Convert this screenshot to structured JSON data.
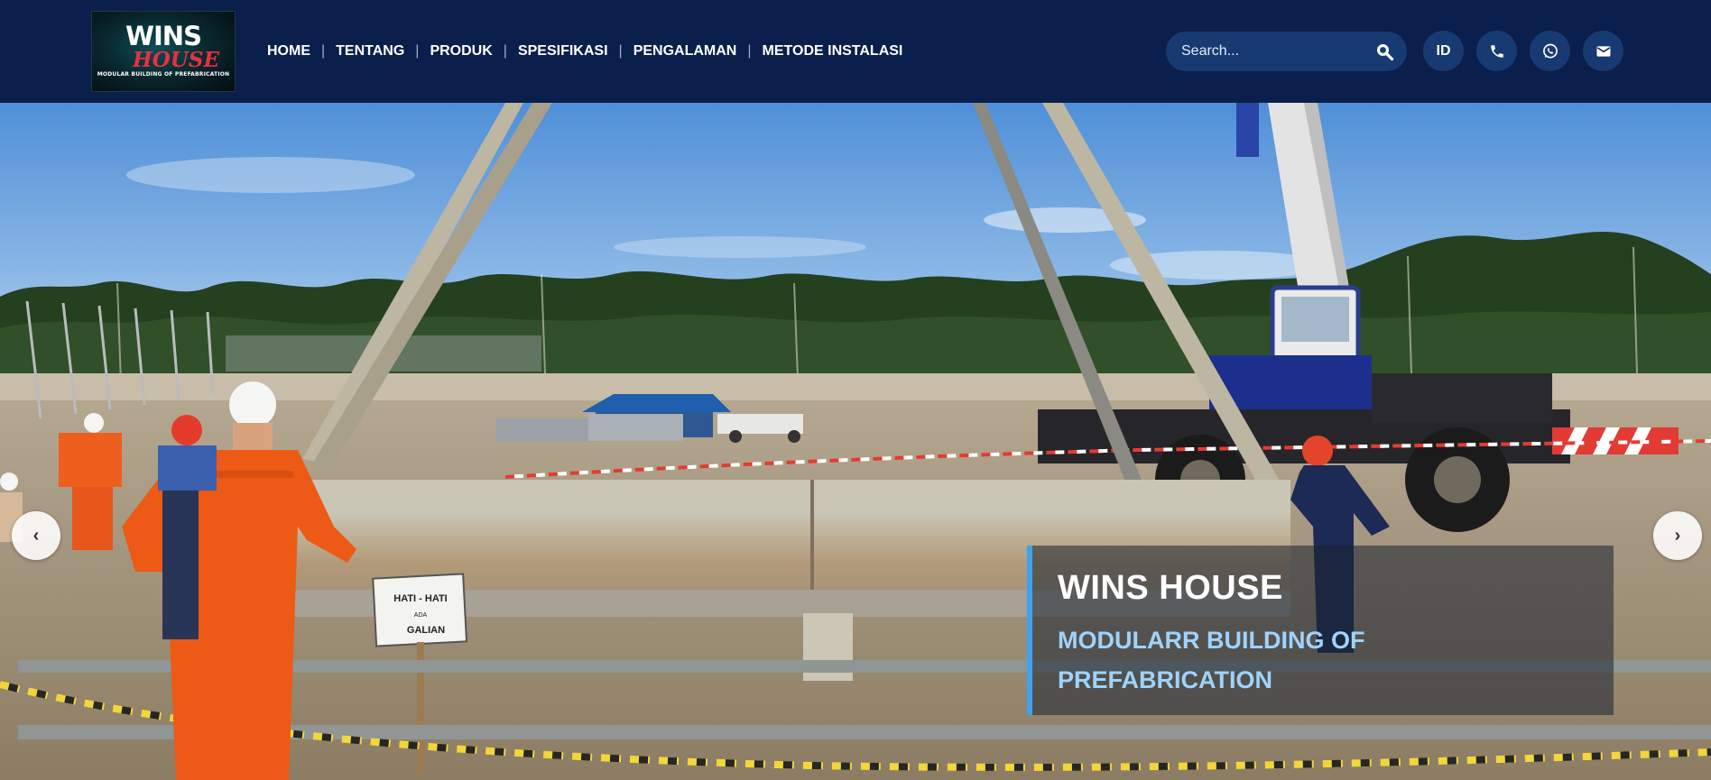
{
  "brand": {
    "logo_line1": "WINS",
    "logo_line2": "HOUSE",
    "logo_tagline": "MODULAR BUILDING OF PREFABRICATION"
  },
  "nav": {
    "items": [
      "HOME",
      "TENTANG",
      "PRODUK",
      "SPESIFIKASI",
      "PENGALAMAN",
      "METODE INSTALASI"
    ],
    "separator": "|"
  },
  "search": {
    "placeholder": "Search..."
  },
  "actions": {
    "language": "ID",
    "phone_icon": "phone-icon",
    "whatsapp_icon": "whatsapp-icon",
    "email_icon": "mail-icon"
  },
  "hero": {
    "prev_arrow": "‹",
    "next_arrow": "›",
    "caption_title": "WINS HOUSE",
    "caption_subtitle": "MODULARR BUILDING OF PREFABRICATION",
    "sign_line1": "HATI - HATI",
    "sign_line2": "ADA",
    "sign_line3": "GALIAN"
  },
  "colors": {
    "header_bg": "#0a1f4b",
    "pill_bg": "#183a72",
    "caption_accent": "#3ea2f0",
    "caption_subtitle": "#9fd3fb"
  }
}
